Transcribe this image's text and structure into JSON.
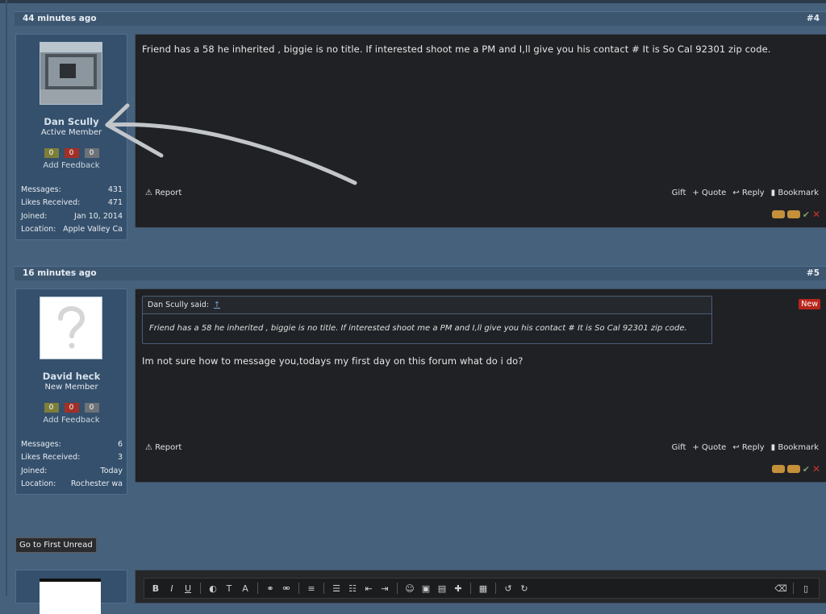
{
  "posts": [
    {
      "age": "44 minutes ago",
      "number": "#4",
      "user": {
        "name": "Dan Scully",
        "title": "Active Member",
        "feedback": [
          "0",
          "0",
          "0"
        ],
        "add_feedback": "Add Feedback",
        "stats": [
          {
            "label": "Messages:",
            "value": "431"
          },
          {
            "label": "Likes Received:",
            "value": "471"
          },
          {
            "label": "Joined:",
            "value": "Jan 10, 2014"
          },
          {
            "label": "Location:",
            "value": "Apple Valley Ca"
          }
        ]
      },
      "message": "Friend has a 58 he inherited , biggie is no title. If interested shoot me a PM and I,ll give you his contact # It is So Cal 92301 zip code.",
      "report": "Report",
      "actions": [
        "Gift",
        "+ Quote",
        "Reply",
        "Bookmark"
      ]
    },
    {
      "age": "16 minutes ago",
      "number": "#5",
      "badge": "New",
      "user": {
        "name": "David heck",
        "title": "New Member",
        "feedback": [
          "0",
          "0",
          "0"
        ],
        "add_feedback": "Add Feedback",
        "stats": [
          {
            "label": "Messages:",
            "value": "6"
          },
          {
            "label": "Likes Received:",
            "value": "3"
          },
          {
            "label": "Joined:",
            "value": "Today"
          },
          {
            "label": "Location:",
            "value": "Rochester wa"
          }
        ]
      },
      "quote": {
        "author": "Dan Scully said:",
        "arrow": "↑",
        "text": "Friend has a 58 he inherited , biggie is no title. If interested shoot me a PM and I,ll give you his contact # It is So Cal 92301 zip code."
      },
      "message": "Im not sure how to message you,todays my first day on this forum what do i do?",
      "report": "Report",
      "actions": [
        "Gift",
        "+ Quote",
        "Reply",
        "Bookmark"
      ]
    }
  ],
  "go_first_unread": "Go to First Unread",
  "colors": {
    "background": "#46617c",
    "post_body": "#202124",
    "user_card": "#35506c",
    "new_badge": "#b8251c"
  }
}
